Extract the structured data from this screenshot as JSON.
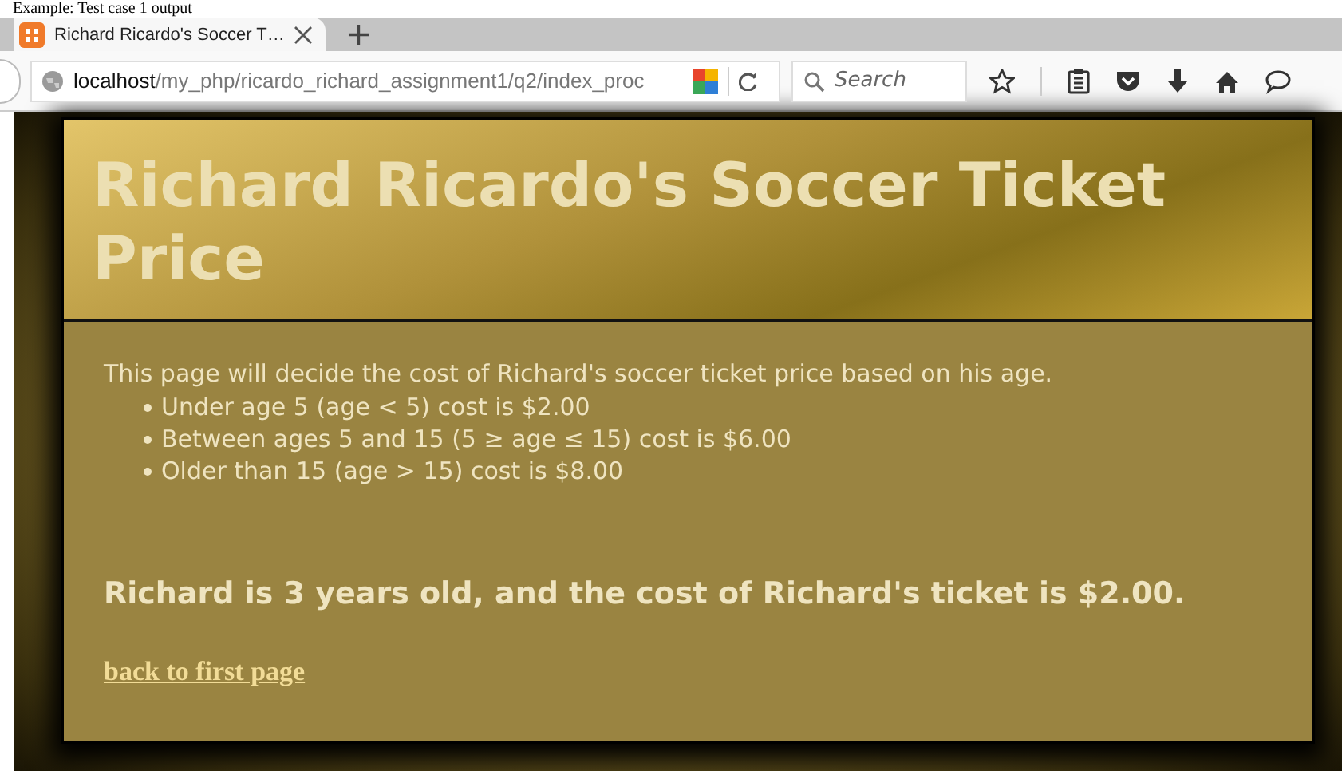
{
  "caption": "Example: Test case 1 output",
  "browser": {
    "tab": {
      "title": "Richard Ricardo's Soccer T…",
      "selected": true
    },
    "new_tab": "+",
    "url": {
      "host": "localhost",
      "path": "/my_php/ricardo_richard_assignment1/q2/index_proc"
    },
    "search": {
      "placeholder": "Search"
    }
  },
  "page": {
    "title": "Richard Ricardo's Soccer Ticket Price",
    "intro": "This page will decide the cost of Richard's soccer ticket price based on his age.",
    "prices": [
      "Under age 5 (age < 5) cost is $2.00",
      "Between ages 5 and 15 (5 ≥ age ≤ 15) cost is $6.00",
      "Older than 15 (age > 15) cost is $8.00"
    ],
    "result": "Richard is 3 years old, and the cost of Richard's ticket is $2.00.",
    "link": "back to first page"
  }
}
